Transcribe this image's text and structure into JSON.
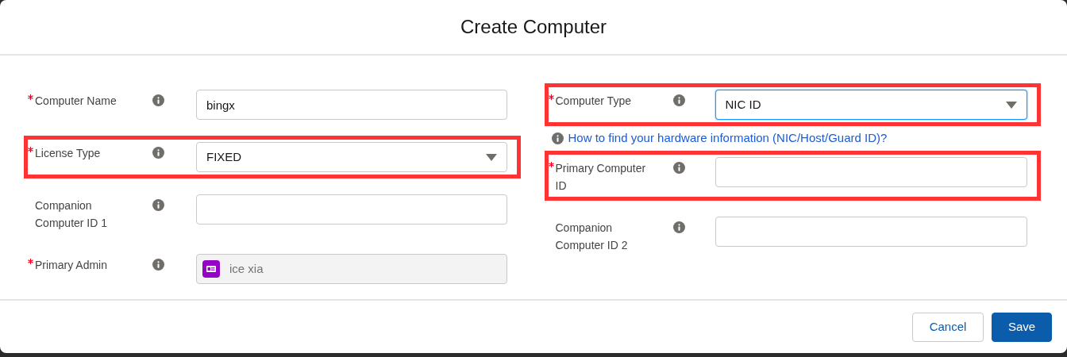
{
  "modal": {
    "title": "Create Computer"
  },
  "left_column": [
    {
      "kind": "text",
      "label": "Computer Name",
      "required": true,
      "value": "bingx",
      "highlighted": false,
      "focused": false
    },
    {
      "kind": "select",
      "label": "License Type",
      "required": true,
      "value": "FIXED",
      "highlighted": true,
      "focused": false
    },
    {
      "kind": "text",
      "label": "Companion Computer ID 1",
      "required": false,
      "highlighted": false,
      "focused": false
    },
    {
      "kind": "lookup",
      "label": "Primary Admin",
      "required": true,
      "value": "ice xia",
      "highlighted": false,
      "focused": false
    }
  ],
  "right_column": [
    {
      "kind": "select",
      "label": "Computer Type",
      "required": true,
      "value": "NIC ID",
      "highlighted": true,
      "focused": true
    },
    {
      "kind": "help_link",
      "text": "How to find your hardware information (NIC/Host/Guard ID)?"
    },
    {
      "kind": "text",
      "label": "Primary Computer ID",
      "required": true,
      "highlighted": true,
      "focused": false
    },
    {
      "kind": "text",
      "label": "Companion Computer ID 2",
      "required": false,
      "highlighted": false,
      "focused": false
    }
  ],
  "footer": {
    "buttons": [
      {
        "label": "Cancel",
        "kind": "neutral"
      },
      {
        "label": "Save",
        "kind": "brand"
      }
    ]
  }
}
